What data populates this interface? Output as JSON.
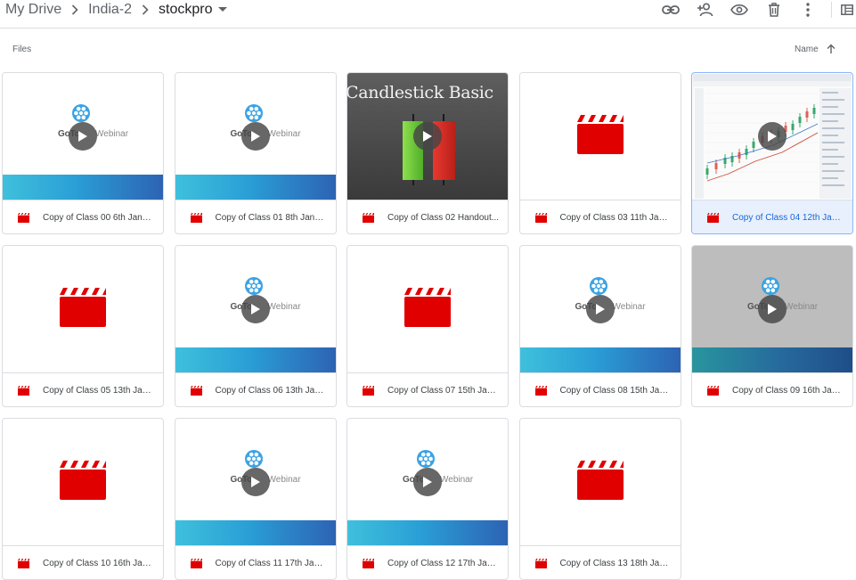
{
  "breadcrumb": [
    "My Drive",
    "India-2",
    "stockpro"
  ],
  "toolbar": {
    "link": "link-icon",
    "share": "add-person-icon",
    "preview": "eye-icon",
    "remove": "trash-icon",
    "more": "more-vert-icon",
    "details": "details-panel-icon"
  },
  "section_label": "Files",
  "sort": {
    "label": "Name",
    "direction": "ascending"
  },
  "colors": {
    "video_red": "#e00000",
    "accent_blue": "#1967d2",
    "selected_bg": "#e8f0fe"
  },
  "thumb_text": {
    "goto_brand": "GoTo",
    "goto_brand2": "Webinar",
    "candlestick_title": "Candlestick Basic"
  },
  "files": [
    {
      "name": "Copy of Class 00 6th January...",
      "thumb": "goto",
      "selected": false
    },
    {
      "name": "Copy of Class 01 8th January...",
      "thumb": "goto",
      "selected": false
    },
    {
      "name": "Copy of Class 02 Handout...",
      "thumb": "candlestick",
      "selected": false
    },
    {
      "name": "Copy of Class 03 11th January...",
      "thumb": "clapper",
      "selected": false
    },
    {
      "name": "Copy of Class 04 12th January...",
      "thumb": "screenshot",
      "selected": true
    },
    {
      "name": "Copy of Class 05 13th January...",
      "thumb": "clapper",
      "selected": false
    },
    {
      "name": "Copy of Class 06 13th January...",
      "thumb": "goto",
      "selected": false
    },
    {
      "name": "Copy of Class 07 15th January...",
      "thumb": "clapper",
      "selected": false
    },
    {
      "name": "Copy of Class 08 15th January...",
      "thumb": "goto",
      "selected": false
    },
    {
      "name": "Copy of Class 09 16th January...",
      "thumb": "goto-gray",
      "selected": false
    },
    {
      "name": "Copy of Class 10 16th January...",
      "thumb": "clapper",
      "selected": false
    },
    {
      "name": "Copy of Class 11 17th January...",
      "thumb": "goto",
      "selected": false
    },
    {
      "name": "Copy of Class 12 17th January...",
      "thumb": "goto",
      "selected": false
    },
    {
      "name": "Copy of Class 13 18th January...",
      "thumb": "clapper",
      "selected": false
    }
  ]
}
